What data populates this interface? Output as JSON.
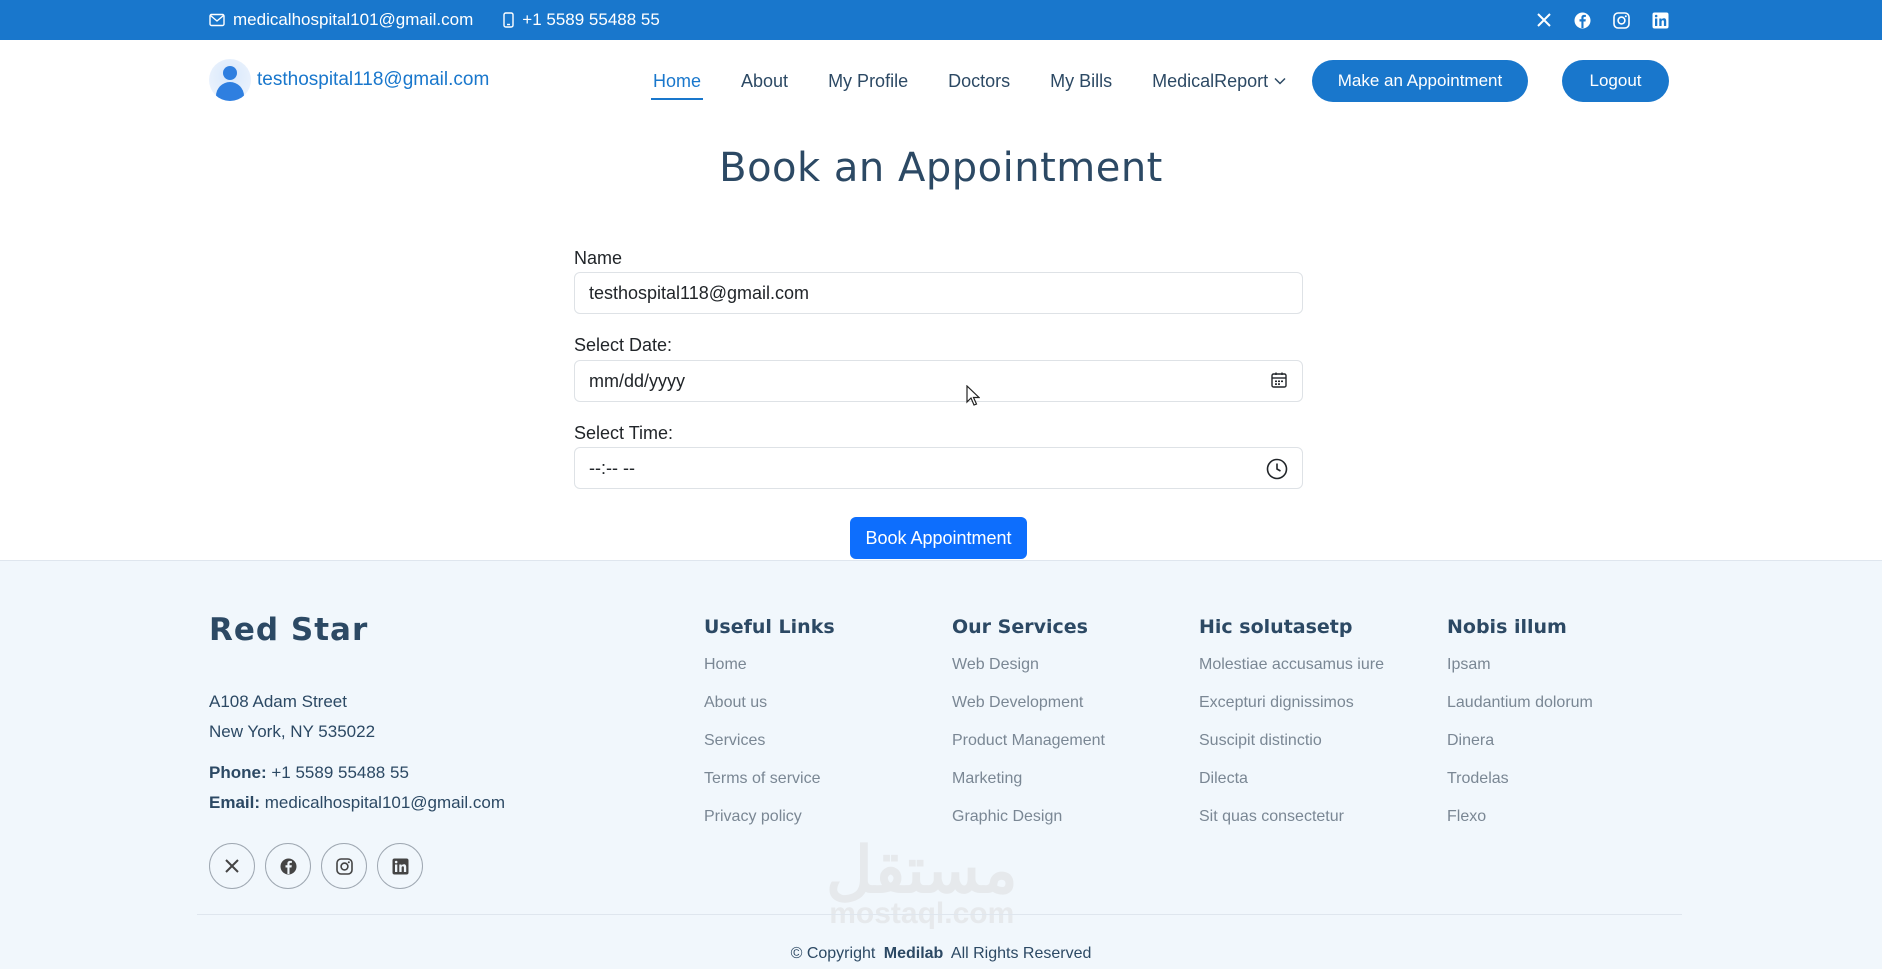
{
  "topbar": {
    "email": "medicalhospital101@gmail.com",
    "phone": "+1 5589 55488 55",
    "social_icons": [
      "x-icon",
      "facebook-icon",
      "instagram-icon",
      "linkedin-icon"
    ]
  },
  "header": {
    "user_email": "testhospital118@gmail.com",
    "nav": [
      {
        "label": "Home",
        "active": true
      },
      {
        "label": "About"
      },
      {
        "label": "My Profile"
      },
      {
        "label": "Doctors"
      },
      {
        "label": "My Bills"
      },
      {
        "label": "MedicalReport",
        "dropdown": true
      }
    ],
    "appointment_button": "Make an Appointment",
    "logout_button": "Logout"
  },
  "form": {
    "title": "Book an Appointment",
    "name_label": "Name",
    "name_value": "testhospital118@gmail.com",
    "date_label": "Select Date:",
    "date_placeholder": "mm/dd/yyyy",
    "time_label": "Select Time:",
    "time_placeholder": "--:-- --",
    "submit_button": "Book Appointment"
  },
  "footer": {
    "brand": "Red Star",
    "address_line1": "A108 Adam Street",
    "address_line2": "New York, NY 535022",
    "phone_label": "Phone:",
    "phone_value": "+1 5589 55488 55",
    "email_label": "Email:",
    "email_value": "medicalhospital101@gmail.com",
    "columns": [
      {
        "title": "Useful Links",
        "links": [
          "Home",
          "About us",
          "Services",
          "Terms of service",
          "Privacy policy"
        ]
      },
      {
        "title": "Our Services",
        "links": [
          "Web Design",
          "Web Development",
          "Product Management",
          "Marketing",
          "Graphic Design"
        ]
      },
      {
        "title": "Hic solutasetp",
        "links": [
          "Molestiae accusamus iure",
          "Excepturi dignissimos",
          "Suscipit distinctio",
          "Dilecta",
          "Sit quas consectetur"
        ]
      },
      {
        "title": "Nobis illum",
        "links": [
          "Ipsam",
          "Laudantium dolorum",
          "Dinera",
          "Trodelas",
          "Flexo"
        ]
      }
    ],
    "copyright_prefix": "© Copyright",
    "copyright_brand": "Medilab",
    "copyright_suffix": "All Rights Reserved",
    "watermark_arabic": "مستقل",
    "watermark_latin": "mostaql.com"
  },
  "colors": {
    "primary": "#1977cc",
    "button": "#0d6efd",
    "heading": "#2c4964",
    "footer_bg": "#f1f7fc"
  }
}
